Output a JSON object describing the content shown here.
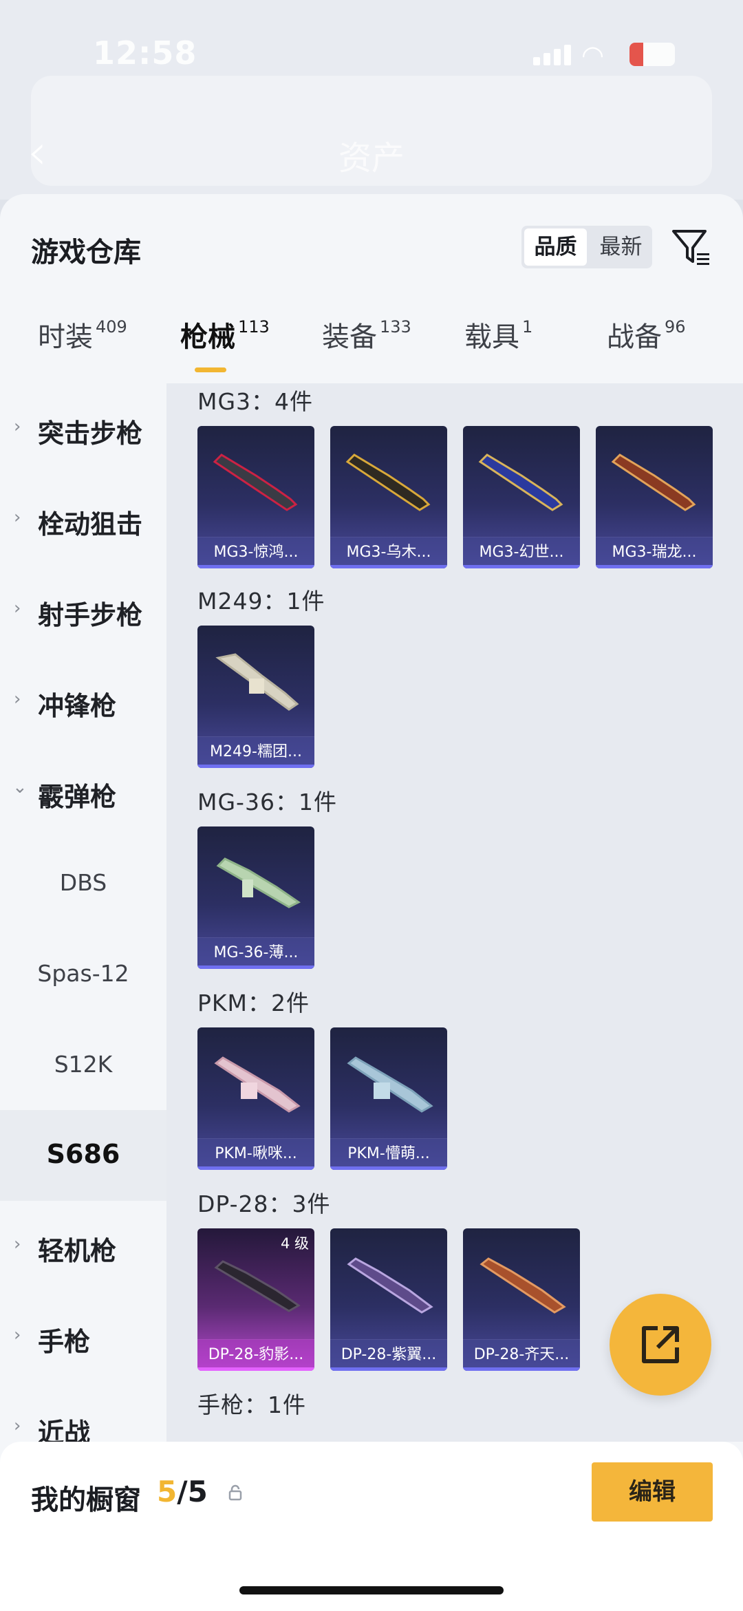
{
  "status_bar": {
    "time": "12:58"
  },
  "nav": {
    "title": "资产"
  },
  "sheet": {
    "title": "游戏仓库",
    "sort_quality": "品质",
    "sort_latest": "最新"
  },
  "tabs": [
    {
      "label": "时装",
      "count": "409"
    },
    {
      "label": "枪械",
      "count": "113"
    },
    {
      "label": "装备",
      "count": "133"
    },
    {
      "label": "载具",
      "count": "1"
    },
    {
      "label": "战备",
      "count": "96"
    }
  ],
  "sidebar": {
    "items": [
      {
        "label": "突击步枪"
      },
      {
        "label": "栓动狙击"
      },
      {
        "label": "射手步枪"
      },
      {
        "label": "冲锋枪"
      },
      {
        "label": "霰弹枪"
      },
      {
        "label": "DBS"
      },
      {
        "label": "Spas-12"
      },
      {
        "label": "S12K"
      },
      {
        "label": "S686"
      },
      {
        "label": "轻机枪"
      },
      {
        "label": "手枪"
      },
      {
        "label": "近战"
      }
    ]
  },
  "groups": [
    {
      "title": "MG3：4件",
      "items": [
        {
          "name": "MG3-惊鸿..."
        },
        {
          "name": "MG3-乌木..."
        },
        {
          "name": "MG3-幻世..."
        },
        {
          "name": "MG3-瑞龙..."
        }
      ]
    },
    {
      "title": "M249：1件",
      "items": [
        {
          "name": "M249-糯团..."
        }
      ]
    },
    {
      "title": "MG-36：1件",
      "items": [
        {
          "name": "MG-36-薄..."
        }
      ]
    },
    {
      "title": "PKM：2件",
      "items": [
        {
          "name": "PKM-啾咪..."
        },
        {
          "name": "PKM-懵萌..."
        }
      ]
    },
    {
      "title": "DP-28：3件",
      "items": [
        {
          "name": "DP-28-豹影...",
          "level": "4 级"
        },
        {
          "name": "DP-28-紫翼..."
        },
        {
          "name": "DP-28-齐天..."
        }
      ]
    },
    {
      "title": "手枪：1件",
      "items": []
    }
  ],
  "bottom": {
    "label": "我的橱窗",
    "current": "5",
    "separator": "/",
    "max": "5",
    "edit": "编辑"
  },
  "colors": {
    "accent": "#f2b632",
    "card_blue": "#2c2f63",
    "card_pink": "#b84ad0"
  },
  "icons": [
    "back-arrow-icon",
    "filter-icon",
    "chevron-right-icon",
    "chevron-down-icon",
    "lock-icon",
    "share-icon"
  ]
}
